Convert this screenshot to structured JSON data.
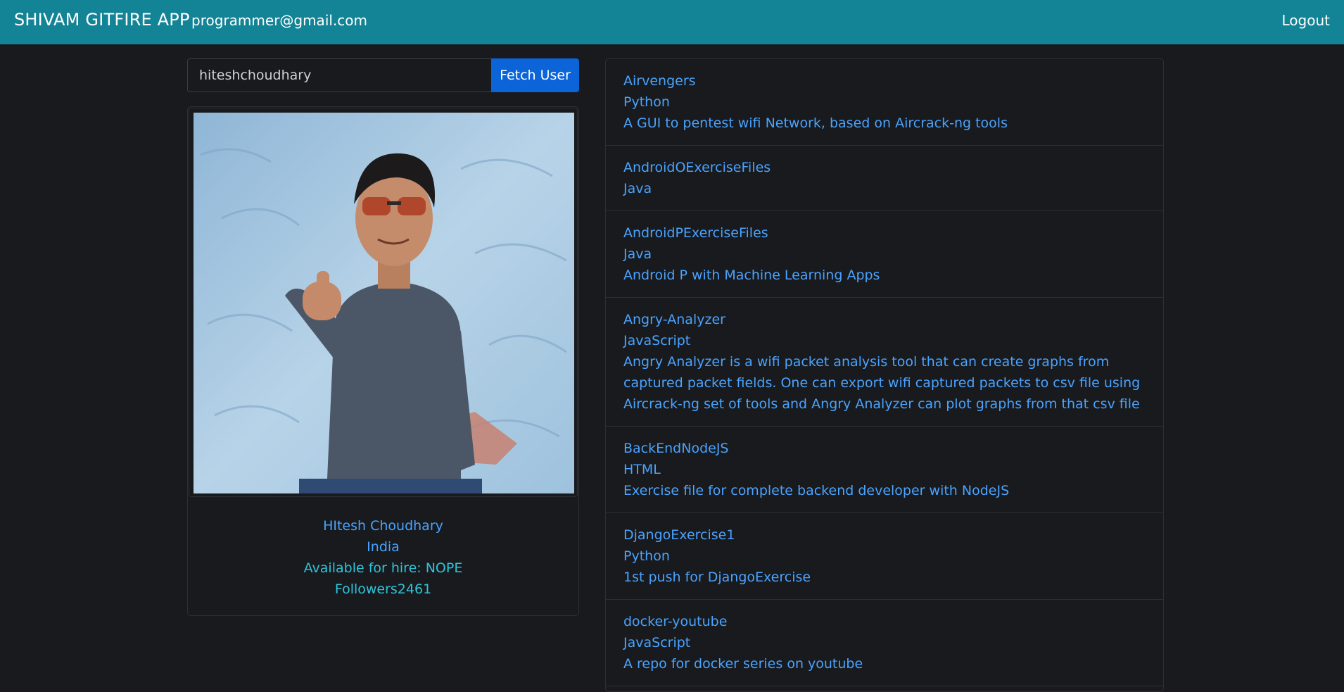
{
  "navbar": {
    "brand": "SHIVAM GITFIRE APP",
    "email": "programmer@gmail.com",
    "logout": "Logout"
  },
  "search": {
    "value": "hiteshchoudhary",
    "button_label": "Fetch User"
  },
  "profile": {
    "name": "HItesh Choudhary",
    "location": "India",
    "hire_status": "Available for hire: NOPE",
    "followers": "Followers2461"
  },
  "repos": [
    {
      "name": "Airvengers",
      "language": "Python",
      "description": "A GUI to pentest wifi Network, based on Aircrack-ng tools"
    },
    {
      "name": "AndroidOExerciseFiles",
      "language": "Java",
      "description": ""
    },
    {
      "name": "AndroidPExerciseFiles",
      "language": "Java",
      "description": "Android P with Machine Learning Apps"
    },
    {
      "name": "Angry-Analyzer",
      "language": "JavaScript",
      "description": "Angry Analyzer is a wifi packet analysis tool that can create graphs from captured packet fields. One can export wifi captured packets to csv file using Aircrack-ng set of tools and Angry Analyzer can plot graphs from that csv file"
    },
    {
      "name": "BackEndNodeJS",
      "language": "HTML",
      "description": "Exercise file for complete backend developer with NodeJS"
    },
    {
      "name": "DjangoExercise1",
      "language": "Python",
      "description": "1st push for DjangoExercise"
    },
    {
      "name": "docker-youtube",
      "language": "JavaScript",
      "description": "A repo for docker series on youtube"
    }
  ],
  "colors": {
    "navbar": "#138496",
    "background": "#181a1d",
    "link": "#4aa3ff",
    "button": "#0b64d8"
  }
}
